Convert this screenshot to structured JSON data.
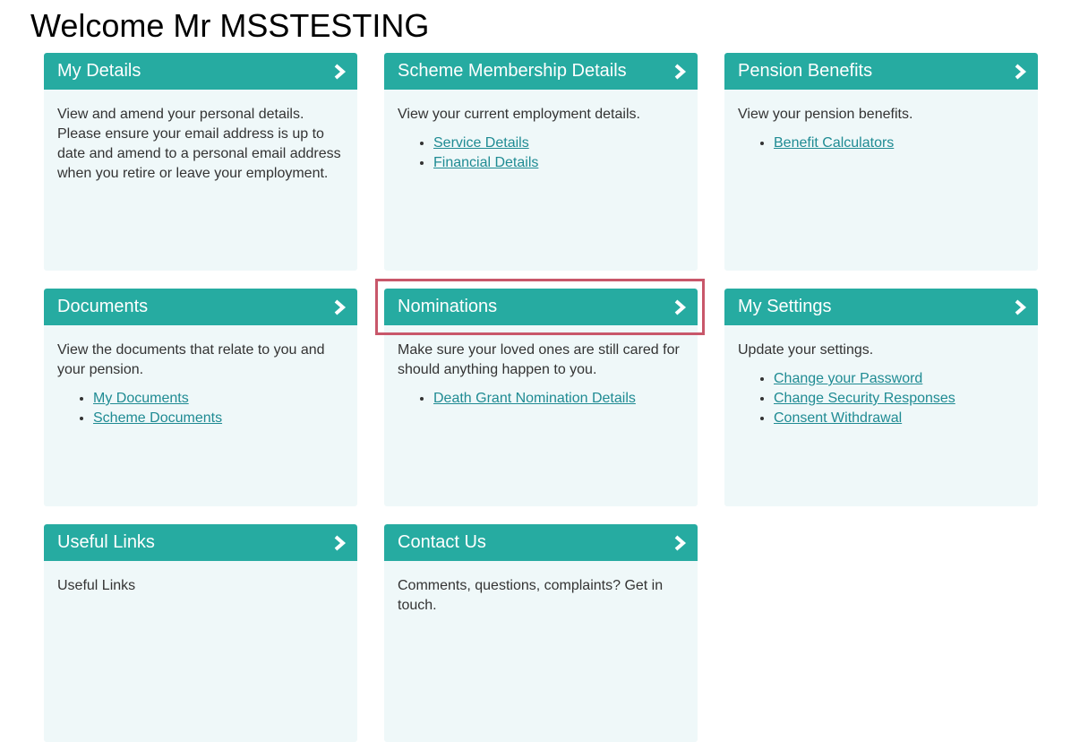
{
  "page": {
    "welcome": "Welcome Mr MSSTESTING"
  },
  "colors": {
    "header_bg": "#26aba1",
    "card_bg": "#eff8f9",
    "link": "#1f8b93",
    "highlight": "#c8576a"
  },
  "cards": [
    {
      "title": "My Details",
      "description": "View and amend your personal details. Please ensure your email address is up to date and amend to a personal email address when you retire or leave your employment.",
      "links": [],
      "icon": "chevron-right-icon"
    },
    {
      "title": "Scheme Membership Details",
      "description": "View your current employment details.",
      "links": [
        "Service Details",
        "Financial Details"
      ],
      "icon": "chevron-right-icon"
    },
    {
      "title": "Pension Benefits",
      "description": "View your pension benefits.",
      "links": [
        "Benefit Calculators"
      ],
      "icon": "chevron-right-icon"
    },
    {
      "title": "Documents",
      "description": "View the documents that relate to you and your pension.",
      "links": [
        "My Documents",
        "Scheme Documents"
      ],
      "icon": "chevron-right-icon"
    },
    {
      "title": "Nominations",
      "description": "Make sure your loved ones are still cared for should anything happen to you.",
      "links": [
        "Death Grant Nomination Details"
      ],
      "icon": "chevron-right-icon",
      "highlighted": true
    },
    {
      "title": "My Settings",
      "description": "Update your settings.",
      "links": [
        "Change your Password",
        "Change Security Responses",
        "Consent Withdrawal"
      ],
      "icon": "chevron-right-icon"
    },
    {
      "title": "Useful Links",
      "description": "Useful Links",
      "links": [],
      "icon": "chevron-right-icon"
    },
    {
      "title": "Contact Us",
      "description": "Comments, questions, complaints? Get in touch.",
      "links": [],
      "icon": "chevron-right-icon"
    }
  ]
}
